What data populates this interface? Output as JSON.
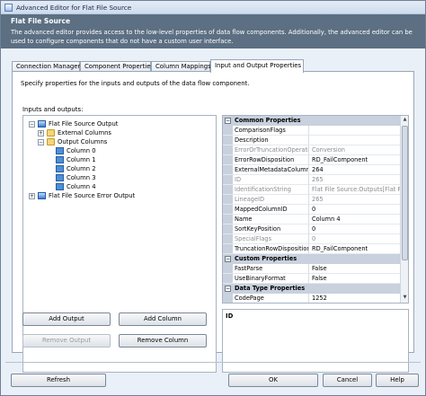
{
  "window": {
    "title": "Advanced Editor for Flat File Source"
  },
  "header": {
    "title": "Flat File Source",
    "description": "The advanced editor provides access to the low-level properties of data flow components. Additionally, the advanced editor can be used to configure components that do not have a custom user interface."
  },
  "tabs": [
    {
      "label": "Connection Managers"
    },
    {
      "label": "Component Properties"
    },
    {
      "label": "Column Mappings"
    },
    {
      "label": "Input and Output Properties",
      "selected": true
    }
  ],
  "panel": {
    "instruction": "Specify properties for the inputs and outputs of the data flow component.",
    "inputs_outputs_label": "Inputs and outputs:"
  },
  "tree": {
    "nodes": [
      {
        "label": "Flat File Source Output",
        "expander": "−",
        "icon": "component-icon"
      },
      {
        "label": "External Columns",
        "expander": "+",
        "icon": "folder-icon"
      },
      {
        "label": "Output Columns",
        "expander": "−",
        "icon": "folder-icon"
      },
      {
        "label": "Column 0",
        "icon": "column-icon"
      },
      {
        "label": "Column 1",
        "icon": "column-icon"
      },
      {
        "label": "Column 2",
        "icon": "column-icon"
      },
      {
        "label": "Column 3",
        "icon": "column-icon"
      },
      {
        "label": "Column 4",
        "icon": "column-icon",
        "selected": true
      },
      {
        "label": "Flat File Source Error Output",
        "expander": "+",
        "icon": "component-icon"
      }
    ]
  },
  "properties": {
    "common_category": "Common Properties",
    "common": [
      {
        "name": "ComparisonFlags",
        "value": ""
      },
      {
        "name": "Description",
        "value": ""
      },
      {
        "name": "ErrorOrTruncationOperation",
        "value": "Conversion",
        "disabled": true
      },
      {
        "name": "ErrorRowDisposition",
        "value": "RD_FailComponent"
      },
      {
        "name": "ExternalMetadataColumnID",
        "value": "264"
      },
      {
        "name": "ID",
        "value": "265",
        "disabled": true
      },
      {
        "name": "IdentificationString",
        "value": "Flat File Source.Outputs[Flat File",
        "disabled": true
      },
      {
        "name": "LineageID",
        "value": "265",
        "disabled": true
      },
      {
        "name": "MappedColumnID",
        "value": "0"
      },
      {
        "name": "Name",
        "value": "Column 4"
      },
      {
        "name": "SortKeyPosition",
        "value": "0"
      },
      {
        "name": "SpecialFlags",
        "value": "0",
        "disabled": true
      },
      {
        "name": "TruncationRowDisposition",
        "value": "RD_FailComponent"
      }
    ],
    "custom_category": "Custom Properties",
    "custom": [
      {
        "name": "FastParse",
        "value": "False"
      },
      {
        "name": "UseBinaryFormat",
        "value": "False"
      }
    ],
    "datatype_category": "Data Type Properties",
    "datatype": [
      {
        "name": "CodePage",
        "value": "1252"
      }
    ]
  },
  "description_box": {
    "title": "ID"
  },
  "buttons": {
    "add_output": "Add Output",
    "add_column": "Add Column",
    "remove_output": "Remove Output",
    "remove_column": "Remove Column",
    "refresh": "Refresh",
    "ok": "OK",
    "cancel": "Cancel",
    "help": "Help"
  }
}
